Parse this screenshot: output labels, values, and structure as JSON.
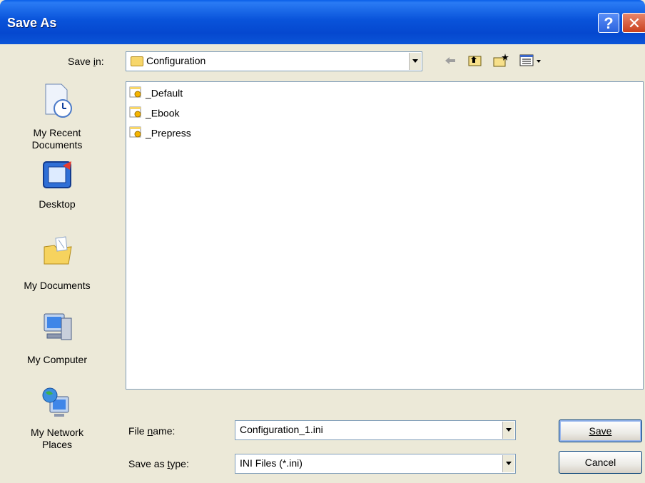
{
  "window": {
    "title": "Save As",
    "help_icon": "?",
    "close_icon": "✕"
  },
  "save_in": {
    "label": "Save in:",
    "value": "Configuration"
  },
  "toolbar": {
    "back_icon": "⇐",
    "up_icon": "folder-up-icon",
    "new_folder_icon": "new-folder-icon",
    "views_icon": "views-menu-icon"
  },
  "places": [
    {
      "label": "My Recent Documents",
      "icon": "recent-documents-icon"
    },
    {
      "label": "Desktop",
      "icon": "desktop-icon"
    },
    {
      "label": "My Documents",
      "icon": "my-documents-icon"
    },
    {
      "label": "My Computer",
      "icon": "my-computer-icon"
    },
    {
      "label": "My Network Places",
      "icon": "network-places-icon"
    }
  ],
  "files": [
    {
      "name": "_Default"
    },
    {
      "name": "_Ebook"
    },
    {
      "name": "_Prepress"
    }
  ],
  "file_name": {
    "label": "File name:",
    "value": "Configuration_1.ini"
  },
  "save_as_type": {
    "label": "Save as type:",
    "value": "INI Files (*.ini)"
  },
  "buttons": {
    "save": "Save",
    "cancel": "Cancel"
  },
  "colors": {
    "titlebar": "#0953DA",
    "dialog_bg": "#ECE9D8",
    "field_border": "#7F9DB9"
  }
}
